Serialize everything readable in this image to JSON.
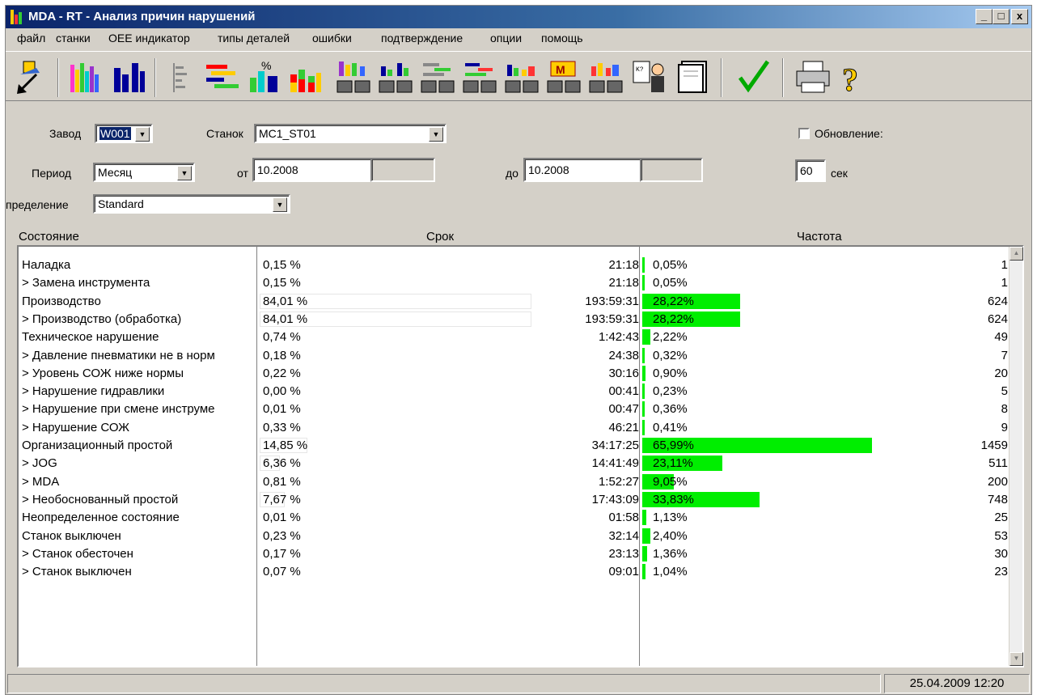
{
  "window": {
    "title": "MDA - RT - Анализ причин нарушений"
  },
  "title_buttons": {
    "minimize": "_",
    "maximize": "□",
    "close": "x"
  },
  "menu": [
    "файл",
    "станки",
    "OEE индикатор",
    "типы деталей",
    "ошибки",
    "подтверждение",
    "опции",
    "помощь"
  ],
  "toolbar_icons": [
    "exit-icon",
    "multi-bar-chart-icon",
    "bar-chart-icon",
    "list-icon",
    "gantt-icon",
    "percent-chart-icon",
    "stacked-bar-icon",
    "chart-machines-icon",
    "chart-machines-2-icon",
    "chart-machines-3-icon",
    "chart-machines-4-icon",
    "chart-machines-5-icon",
    "chart-machines-6-icon",
    "chart-machines-7-icon",
    "operator-report-icon",
    "document-icon",
    "checkmark-icon",
    "printer-icon",
    "help-icon"
  ],
  "form": {
    "plant_label": "Завод",
    "plant_value": "W001",
    "machine_label": "Станок",
    "machine_value": "MC1_ST01",
    "refresh_label": "Обновление:",
    "period_label": "Период",
    "period_value": "Месяц",
    "from_label": "от",
    "from_value": "10.2008",
    "to_label": "до",
    "to_value": "10.2008",
    "refresh_seconds": "60",
    "seconds_label": "сек",
    "definition_label": "пределение",
    "definition_value": "Standard"
  },
  "grid": {
    "headers": {
      "state": "Состояние",
      "duration": "Срок",
      "frequency": "Частота"
    },
    "rows": [
      {
        "name": "Наладка",
        "pct": "0,15 %",
        "pct_value": 0.15,
        "time": "21:18",
        "freq_pct": "0,05%",
        "freq_value": 0.05,
        "count": "1"
      },
      {
        "name": "> Замена инструмента",
        "pct": "0,15 %",
        "pct_value": 0.15,
        "time": "21:18",
        "freq_pct": "0,05%",
        "freq_value": 0.05,
        "count": "1"
      },
      {
        "name": "Производство",
        "pct": "84,01 %",
        "pct_value": 84.01,
        "time": "193:59:31",
        "freq_pct": "28,22%",
        "freq_value": 28.22,
        "count": "624"
      },
      {
        "name": "> Производство (обработка)",
        "pct": "84,01 %",
        "pct_value": 84.01,
        "time": "193:59:31",
        "freq_pct": "28,22%",
        "freq_value": 28.22,
        "count": "624"
      },
      {
        "name": "Техническое нарушение",
        "pct": "0,74 %",
        "pct_value": 0.74,
        "time": "1:42:43",
        "freq_pct": "2,22%",
        "freq_value": 2.22,
        "count": "49"
      },
      {
        "name": "> Давление пневматики не в норм",
        "pct": "0,18 %",
        "pct_value": 0.18,
        "time": "24:38",
        "freq_pct": "0,32%",
        "freq_value": 0.32,
        "count": "7"
      },
      {
        "name": "> Уровень СОЖ ниже нормы",
        "pct": "0,22 %",
        "pct_value": 0.22,
        "time": "30:16",
        "freq_pct": "0,90%",
        "freq_value": 0.9,
        "count": "20"
      },
      {
        "name": "> Нарушение гидравлики",
        "pct": "0,00 %",
        "pct_value": 0.0,
        "time": "00:41",
        "freq_pct": "0,23%",
        "freq_value": 0.23,
        "count": "5"
      },
      {
        "name": "> Нарушение при смене инструме",
        "pct": "0,01 %",
        "pct_value": 0.01,
        "time": "00:47",
        "freq_pct": "0,36%",
        "freq_value": 0.36,
        "count": "8"
      },
      {
        "name": "> Нарушение СОЖ",
        "pct": "0,33 %",
        "pct_value": 0.33,
        "time": "46:21",
        "freq_pct": "0,41%",
        "freq_value": 0.41,
        "count": "9"
      },
      {
        "name": "Организационный простой",
        "pct": "14,85 %",
        "pct_value": 14.85,
        "time": "34:17:25",
        "freq_pct": "65,99%",
        "freq_value": 65.99,
        "count": "1459"
      },
      {
        "name": "> JOG",
        "pct": "6,36 %",
        "pct_value": 6.36,
        "time": "14:41:49",
        "freq_pct": "23,11%",
        "freq_value": 23.11,
        "count": "511"
      },
      {
        "name": "> MDA",
        "pct": "0,81 %",
        "pct_value": 0.81,
        "time": "1:52:27",
        "freq_pct": "9,05%",
        "freq_value": 9.05,
        "count": "200"
      },
      {
        "name": "> Необоснованный простой",
        "pct": "7,67 %",
        "pct_value": 7.67,
        "time": "17:43:09",
        "freq_pct": "33,83%",
        "freq_value": 33.83,
        "count": "748"
      },
      {
        "name": "Неопределенное состояние",
        "pct": "0,01 %",
        "pct_value": 0.01,
        "time": "01:58",
        "freq_pct": "1,13%",
        "freq_value": 1.13,
        "count": "25"
      },
      {
        "name": "Станок выключен",
        "pct": "0,23 %",
        "pct_value": 0.23,
        "time": "32:14",
        "freq_pct": "2,40%",
        "freq_value": 2.4,
        "count": "53"
      },
      {
        "name": "> Станок обесточен",
        "pct": "0,17 %",
        "pct_value": 0.17,
        "time": "23:13",
        "freq_pct": "1,36%",
        "freq_value": 1.36,
        "count": "30"
      },
      {
        "name": "> Станок выключен",
        "pct": "0,07 %",
        "pct_value": 0.07,
        "time": "09:01",
        "freq_pct": "1,04%",
        "freq_value": 1.04,
        "count": "23"
      }
    ]
  },
  "status": {
    "left_text": "",
    "datetime": "25.04.2009 12:20"
  },
  "colors": {
    "freq_bar": "#00ee00",
    "title_bar": "#0a246a",
    "window_bg": "#d4d0c8"
  }
}
